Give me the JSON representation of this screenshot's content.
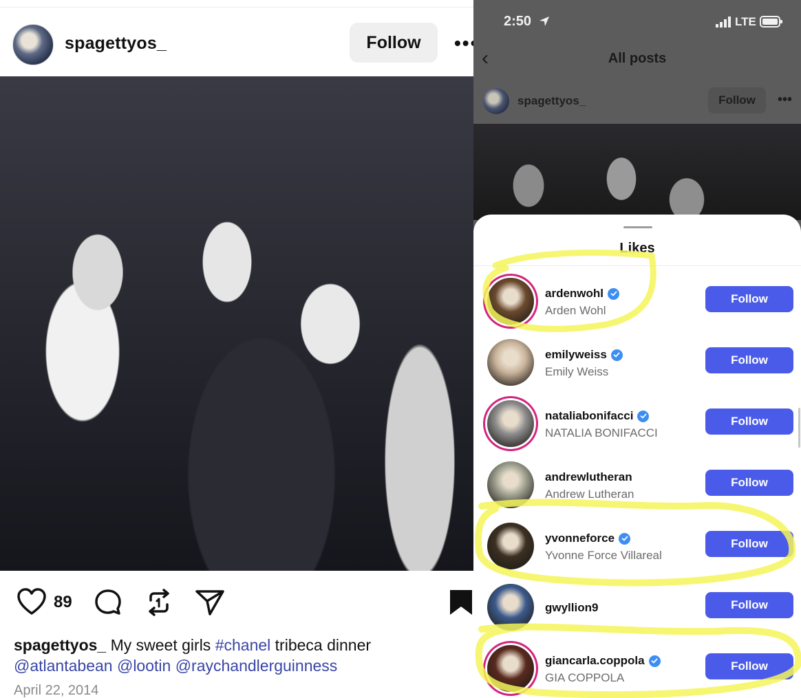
{
  "post": {
    "username": "spagettyos_",
    "follow_label": "Follow",
    "more_label": "•••",
    "likes_count": "89",
    "caption_username": "spagettyos_",
    "caption_text_1": "My sweet girls",
    "caption_hashtag": "#chanel",
    "caption_text_2": "tribeca dinner",
    "mention_1": "@atlantabean",
    "mention_2": "@lootin",
    "mention_3": "@raychandlerguinness",
    "date": "April 22, 2014"
  },
  "phone": {
    "status_time": "2:50",
    "network_label": "LTE",
    "nav_title": "All posts",
    "mini_username": "spagettyos_",
    "mini_follow_label": "Follow",
    "mini_more_label": "•••"
  },
  "likes_sheet": {
    "title": "Likes",
    "users": [
      {
        "username": "ardenwohl",
        "full_name": "Arden Wohl",
        "verified": true,
        "story_ring": true,
        "button": "Follow",
        "avatar_color": "#6b4a2e"
      },
      {
        "username": "emilyweiss",
        "full_name": "Emily Weiss",
        "verified": true,
        "story_ring": false,
        "button": "Follow",
        "avatar_color": "#c9b39a"
      },
      {
        "username": "nataliabonifacci",
        "full_name": "NATALIA BONIFACCI",
        "verified": true,
        "story_ring": true,
        "button": "Follow",
        "avatar_color": "#8d8d8d"
      },
      {
        "username": "andrewlutheran",
        "full_name": "Andrew Lutheran",
        "verified": false,
        "story_ring": false,
        "button": "Follow",
        "avatar_color": "#9ea08f"
      },
      {
        "username": "yvonneforce",
        "full_name": "Yvonne Force Villareal",
        "verified": true,
        "story_ring": false,
        "button": "Follow",
        "avatar_color": "#3b3022"
      },
      {
        "username": "gwyllion9",
        "full_name": "",
        "verified": false,
        "story_ring": false,
        "button": "Follow",
        "avatar_color": "#3c5a8c"
      },
      {
        "username": "giancarla.coppola",
        "full_name": "GIA COPPOLA",
        "verified": true,
        "story_ring": true,
        "button": "Follow",
        "avatar_color": "#5a2a1e"
      }
    ]
  },
  "colors": {
    "follow_blue": "#4b5be9",
    "verified_blue": "#3d8ef2",
    "highlight_yellow": "#f4f55a",
    "story_ring": "#d3247f"
  }
}
